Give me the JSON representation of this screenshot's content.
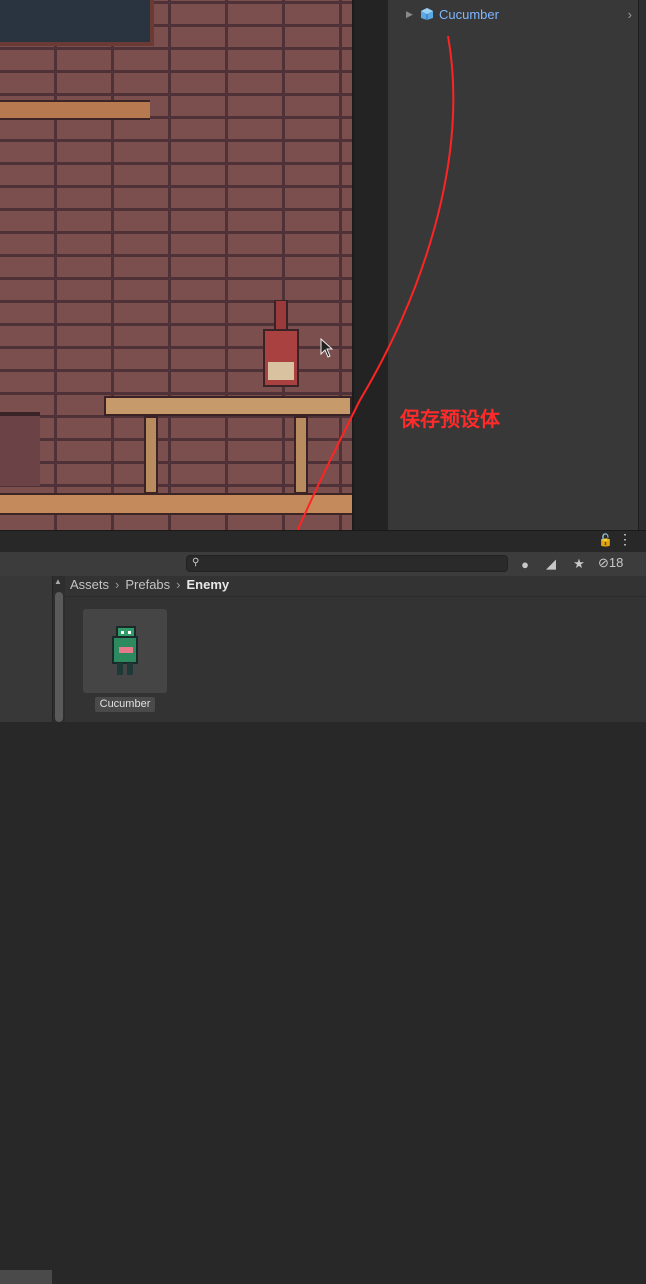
{
  "hierarchy": {
    "item_label": "Cucumber"
  },
  "annotation": {
    "text": "保存预设体",
    "color": "#ff2b2b"
  },
  "project": {
    "breadcrumb": [
      "Assets",
      "Prefabs",
      "Enemy"
    ],
    "search_placeholder": "",
    "hidden_count": "18",
    "asset_label": "Cucumber"
  },
  "icons": {
    "lock": "lock-icon",
    "more": "more-vert-icon",
    "search": "search-icon",
    "type_filter": "type-filter-icon",
    "label_filter": "label-filter-icon",
    "favorite": "star-icon",
    "hidden_toggle": "eye-slash-icon"
  }
}
